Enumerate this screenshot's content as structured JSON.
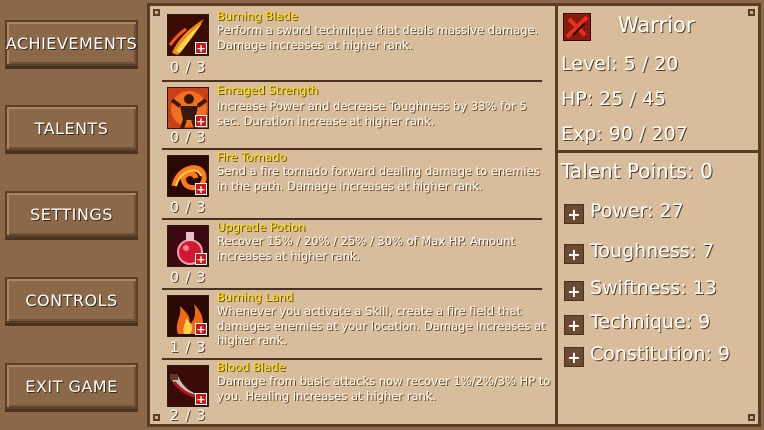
{
  "menu": {
    "achievements": "ACHIEVEMENTS",
    "talents": "TALENTS",
    "settings": "SETTINGS",
    "controls": "CONTROLS",
    "exit": "EXIT GAME"
  },
  "talents": [
    {
      "name": "Burning Blade",
      "desc": "Perform a sword technique that deals massive damage. Damage increases at higher rank.",
      "rank": "0 / 3",
      "icon": "burning-blade-icon"
    },
    {
      "name": "Enraged Strength",
      "desc": "Increase Power and decrease Toughness by 33% for 5 sec. Duration increase at higher rank.",
      "rank": "0 / 3",
      "icon": "enraged-strength-icon"
    },
    {
      "name": "Fire Tornado",
      "desc": "Send a fire tornado forward dealing damage to enemies in the path. Damage increases at higher rank.",
      "rank": "0 / 3",
      "icon": "fire-tornado-icon"
    },
    {
      "name": "Upgrade Potion",
      "desc": "Recover 15% / 20% / 25% / 30% of Max HP. Amount increases at higher rank.",
      "rank": "0 / 3",
      "icon": "potion-icon"
    },
    {
      "name": "Burning Land",
      "desc": "Whenever you activate a Skill, create a fire field that damages enemies at your location. Damage increases at higher rank.",
      "rank": "1 / 3",
      "icon": "burning-land-icon"
    },
    {
      "name": "Blood Blade",
      "desc": "Damage from basic attacks now recover 1%/2%/3% HP to you. Healing increases at higher rank.",
      "rank": "2 / 3",
      "icon": "blood-blade-icon"
    }
  ],
  "character": {
    "class_name": "Warrior",
    "level": "Level: 5 / 20",
    "hp": "HP: 25 / 45",
    "exp": "Exp: 90 / 207",
    "talent_points": "Talent Points: 0",
    "stats": [
      {
        "label": "Power: 27"
      },
      {
        "label": "Toughness: 7"
      },
      {
        "label": "Swiftness: 13"
      },
      {
        "label": "Technique: 9"
      },
      {
        "label": "Constitution: 9"
      }
    ],
    "plus_symbol": "+"
  },
  "colors": {
    "talent_name": "#ffe600",
    "panel_bg": "#d8bd9c",
    "border": "#5a3b24",
    "plus_badge": "#c81818"
  }
}
